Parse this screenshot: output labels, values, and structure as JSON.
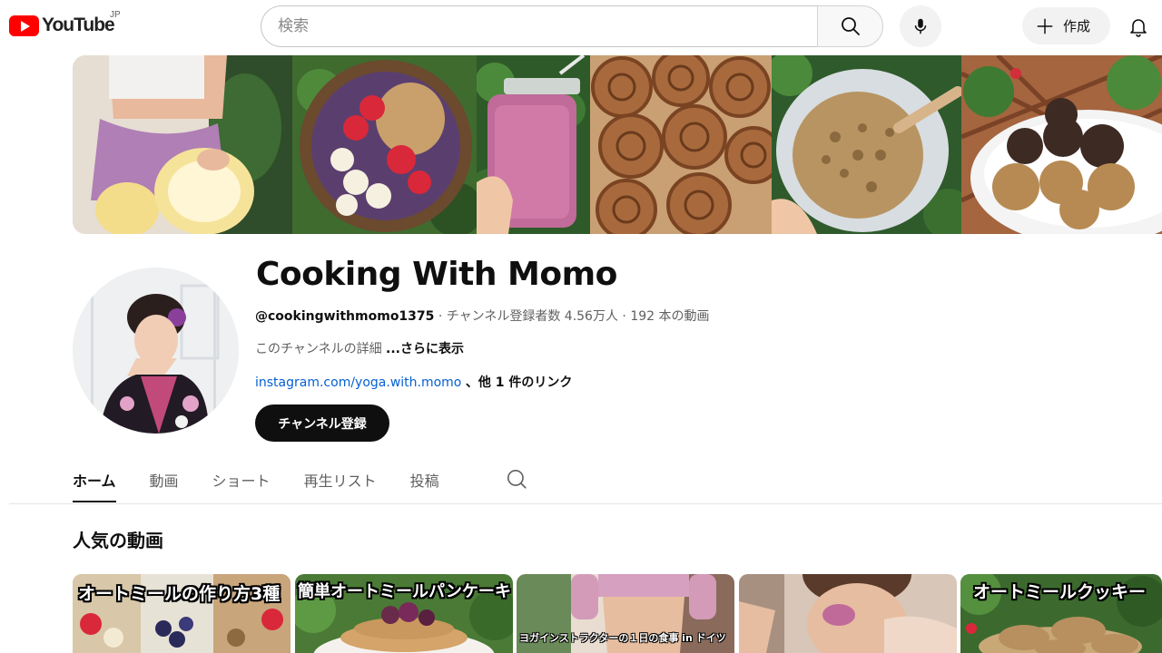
{
  "masthead": {
    "logo_text": "YouTube",
    "country_code": "JP",
    "search_placeholder": "検索",
    "create_label": "作成",
    "icons": [
      "youtube-logo",
      "search-icon",
      "mic-icon",
      "plus-icon",
      "bell-icon"
    ]
  },
  "channel": {
    "name": "Cooking With Momo",
    "handle": "@cookingwithmomo1375",
    "separator": " · ",
    "subscribers": "チャンネル登録者数 4.56万人",
    "videos": "192 本の動画",
    "description": "このチャンネルの詳細",
    "description_more": "...さらに表示",
    "link_url": "instagram.com/yoga.with.momo",
    "link_other": "、他 1 件のリンク",
    "subscribe_label": "チャンネル登録"
  },
  "tabs": [
    {
      "label": "ホーム",
      "active": true
    },
    {
      "label": "動画",
      "active": false
    },
    {
      "label": "ショート",
      "active": false
    },
    {
      "label": "再生リスト",
      "active": false
    },
    {
      "label": "投稿",
      "active": false
    }
  ],
  "popular": {
    "title": "人気の動画",
    "videos": [
      {
        "title": "オートミールの作り方3種"
      },
      {
        "title": "簡単オートミールパンケーキ"
      },
      {
        "title": "ヨガインストラクターの１日の食事 in ドイツ"
      },
      {
        "title": ""
      },
      {
        "title": "オートミールクッキー"
      }
    ]
  },
  "colors": {
    "brand_red": "#ff0000",
    "link_blue": "#065fd4",
    "text_primary": "#0f0f0f",
    "text_secondary": "#606060"
  }
}
